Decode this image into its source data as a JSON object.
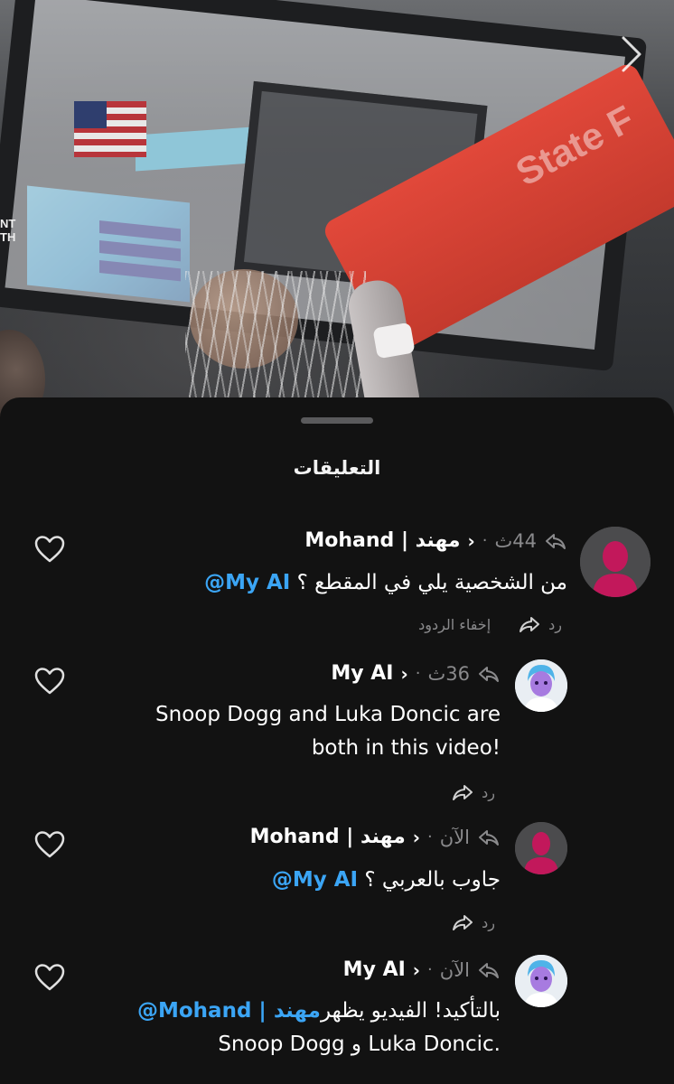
{
  "video": {
    "side_text": "NT\nTH",
    "rim_text": "State F"
  },
  "sheet": {
    "title": "التعليقات"
  },
  "comments": [
    {
      "username": "مهند | Mohand",
      "time": "44ث",
      "text_prefix": "من الشخصية يلي في المقطع ؟ ",
      "mention": "@My AI",
      "reply_label": "رد",
      "hide_label": "إخفاء الردود"
    },
    {
      "username": "My AI",
      "time": "36ث",
      "text_line1": "Snoop Dogg and Luka Doncic are",
      "text_line2": "both in this video!",
      "reply_label": "رد"
    },
    {
      "username": "مهند | Mohand",
      "time": "الآن",
      "text_prefix": "جاوب بالعربي ؟ ",
      "mention": "@My AI",
      "reply_label": "رد"
    },
    {
      "username": "My AI",
      "time": "الآن",
      "mention": "@Mohand | مهند",
      "text_rest": " بالتأكيد! الفيديو يظهر",
      "text_line2": "Snoop Dogg و Luka Doncic."
    }
  ],
  "colors": {
    "mention": "#3ba5f5",
    "muted": "#8a8a8c",
    "sheet_bg": "#121212",
    "user_avatar": "#c2185b"
  },
  "icons": [
    "chevron-right-icon",
    "share-icon",
    "reply-icon",
    "heart-icon",
    "user-silhouette-icon",
    "ai-bitmoji-icon"
  ]
}
